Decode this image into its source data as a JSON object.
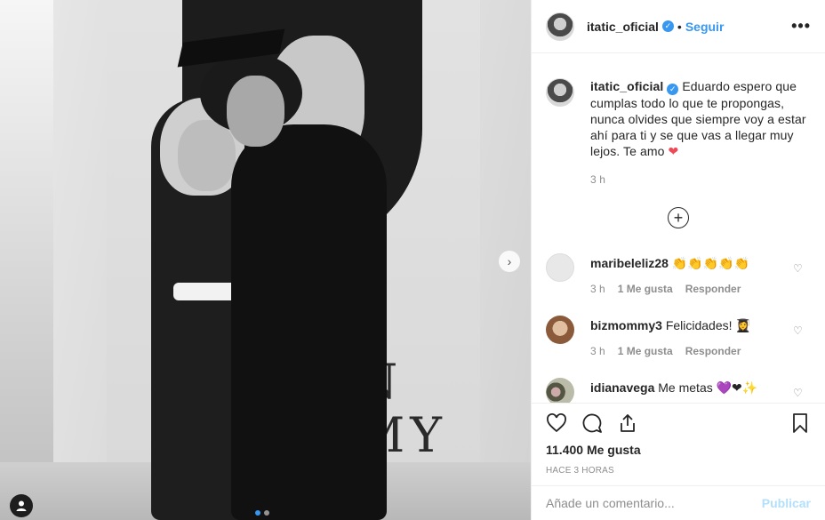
{
  "post": {
    "username": "itatic_oficial",
    "follow_label": "Seguir",
    "dot": "•",
    "more_label": "•••"
  },
  "photo": {
    "banner_text": "N\nMY"
  },
  "caption": {
    "username": "itatic_oficial",
    "text": "Eduardo espero que cumplas todo lo que te propongas, nunca olvides que siempre voy a estar ahí para ti y se que vas a llegar muy lejos. Te amo",
    "emoji": "❤",
    "time": "3 h"
  },
  "load_more_label": "+",
  "comments": [
    {
      "username": "maribeleliz28",
      "text": "👏👏👏👏👏",
      "time": "3 h",
      "likes": "1 Me gusta",
      "reply": "Responder",
      "avatar_color": "#e8e8e8"
    },
    {
      "username": "bizmommy3",
      "text": "Felicidades! 👩‍🎓",
      "time": "3 h",
      "likes": "1 Me gusta",
      "reply": "Responder",
      "avatar_color": "#c9a27a"
    },
    {
      "username": "idianavega",
      "text": "Me metas 💜❤✨",
      "time": "",
      "likes": "",
      "reply": "",
      "avatar_color": "#7a6a5a"
    }
  ],
  "actions": {
    "likes_count": "11.400 Me gusta",
    "timestamp": "HACE 3 HORAS"
  },
  "add_comment": {
    "placeholder": "Añade un comentario...",
    "post_label": "Publicar"
  },
  "colors": {
    "accent": "#3897f0",
    "heart": "#ed4956",
    "muted": "#8e8e8e"
  },
  "carousel": {
    "count": 2,
    "active": 1
  }
}
